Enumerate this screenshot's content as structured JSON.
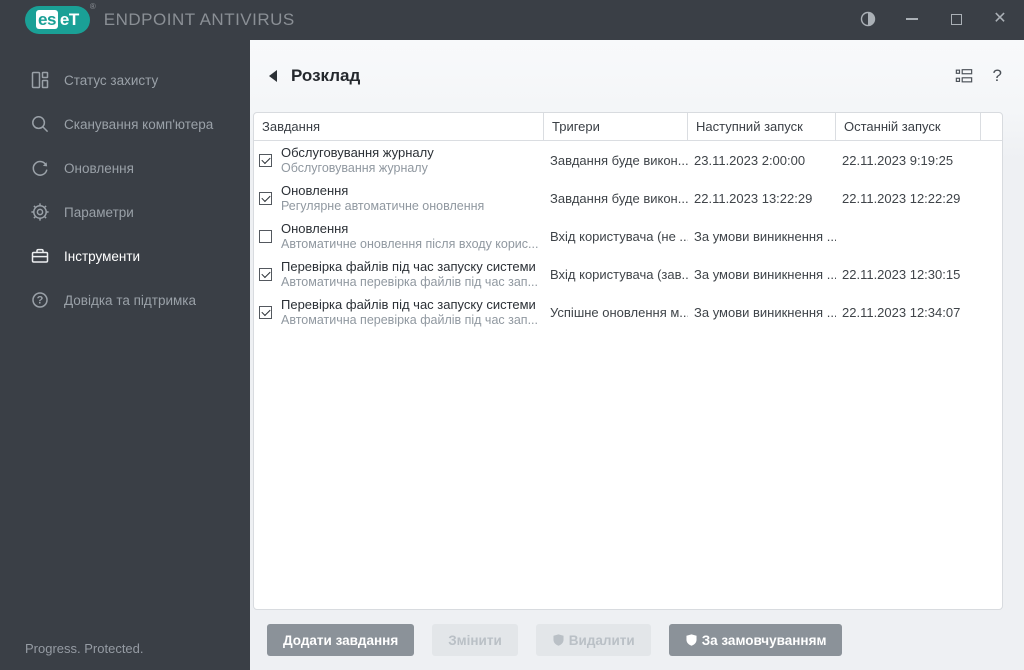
{
  "brand": {
    "logo_left": "es",
    "logo_right": "eT",
    "registered": "®",
    "product": "ENDPOINT ANTIVIRUS"
  },
  "window": {
    "close_glyph": "✕"
  },
  "sidebar": {
    "items": [
      {
        "label": "Статус захисту",
        "icon": "dashboard-icon",
        "active": false
      },
      {
        "label": "Сканування комп'ютера",
        "icon": "search-icon",
        "active": false
      },
      {
        "label": "Оновлення",
        "icon": "refresh-icon",
        "active": false
      },
      {
        "label": "Параметри",
        "icon": "gear-icon",
        "active": false
      },
      {
        "label": "Інструменти",
        "icon": "toolbox-icon",
        "active": true
      },
      {
        "label": "Довідка та підтримка",
        "icon": "help-circle-icon",
        "active": false
      }
    ],
    "footer": "Progress. Protected."
  },
  "main": {
    "title": "Розклад",
    "help_glyph": "?",
    "table": {
      "columns": [
        "Завдання",
        "Тригери",
        "Наступний запуск",
        "Останній запуск",
        ""
      ],
      "rows": [
        {
          "checked": true,
          "name": "Обслуговування журналу",
          "description": "Обслуговування журналу",
          "trigger": "Завдання буде викон...",
          "next_run": "23.11.2023 2:00:00",
          "last_run": "22.11.2023 9:19:25"
        },
        {
          "checked": true,
          "name": "Оновлення",
          "description": "Регулярне автоматичне оновлення",
          "trigger": "Завдання буде викон...",
          "next_run": "22.11.2023 13:22:29",
          "last_run": "22.11.2023 12:22:29"
        },
        {
          "checked": false,
          "name": "Оновлення",
          "description": "Автоматичне оновлення після входу корис...",
          "trigger": "Вхід користувача (не ...",
          "next_run": "За умови виникнення ...",
          "last_run": ""
        },
        {
          "checked": true,
          "name": "Перевірка файлів під час запуску системи",
          "description": "Автоматична перевірка файлів під час зап...",
          "trigger": "Вхід користувача (зав...",
          "next_run": "За умови виникнення ...",
          "last_run": "22.11.2023 12:30:15"
        },
        {
          "checked": true,
          "name": "Перевірка файлів під час запуску системи",
          "description": "Автоматична перевірка файлів під час зап...",
          "trigger": "Успішне оновлення м...",
          "next_run": "За умови виникнення ...",
          "last_run": "22.11.2023 12:34:07"
        }
      ]
    },
    "buttons": [
      {
        "label": "Додати завдання",
        "disabled": false,
        "shield": false
      },
      {
        "label": "Змінити",
        "disabled": true,
        "shield": false
      },
      {
        "label": "Видалити",
        "disabled": true,
        "shield": true
      },
      {
        "label": "За замовчуванням",
        "disabled": false,
        "shield": true
      }
    ]
  },
  "colors": {
    "brand_teal": "#1aa096",
    "dark_chrome": "#3a3f46",
    "content_bg": "#eef0f3",
    "panel_bg": "#ffffff",
    "panel_border": "#d8dbdf",
    "button_enabled": "#8b9299",
    "button_disabled": "#e3e6e9"
  }
}
